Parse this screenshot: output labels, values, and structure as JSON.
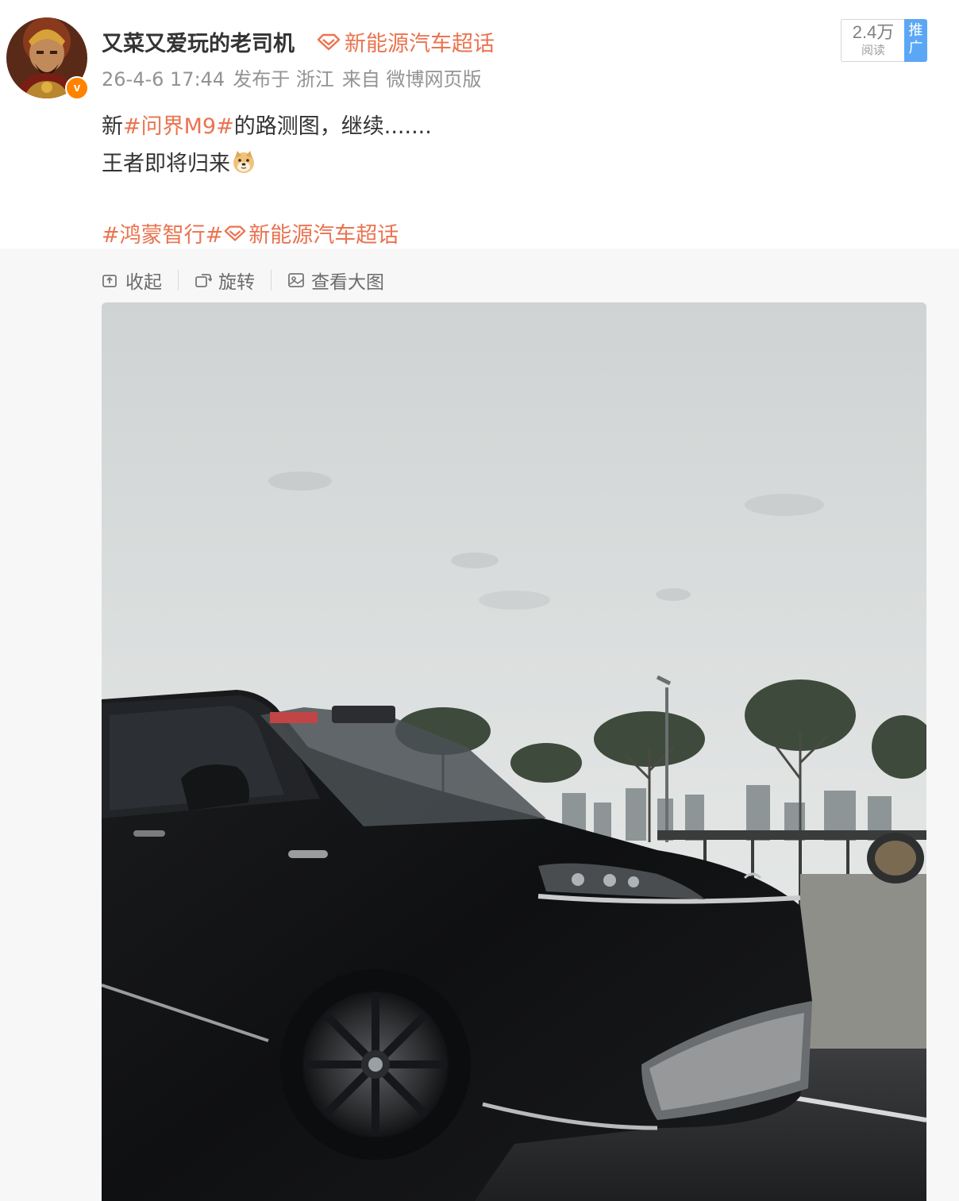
{
  "post": {
    "author": "又菜又爱玩的老司机",
    "verified_badge": "v",
    "supertopic": "新能源汽车超话",
    "meta": {
      "time": "26-4-6 17:44",
      "published_in": "发布于 浙江",
      "source": "来自 微博网页版"
    },
    "reads": {
      "count": "2.4万",
      "label": "阅读"
    },
    "promo_label": "推广",
    "content": {
      "line1_prefix": "新",
      "line1_tag": "#问界M9#",
      "line1_suffix": "的路测图，继续.......",
      "line2_text": "王者即将归来",
      "line2_emoji": "doge-emoji",
      "tag1": "#鸿蒙智行#",
      "tag2": "新能源汽车超话"
    }
  },
  "media_toolbar": {
    "collapse": "收起",
    "rotate": "旋转",
    "view_large": "查看大图"
  },
  "photo": {
    "subject": "black SUV road test photo",
    "sky_color": "#d9dcdc",
    "body_color": "#151617"
  },
  "colors": {
    "accent": "#eb7350",
    "meta": "#939393",
    "verified": "#ff8200",
    "promo": "#5ba7f5"
  }
}
